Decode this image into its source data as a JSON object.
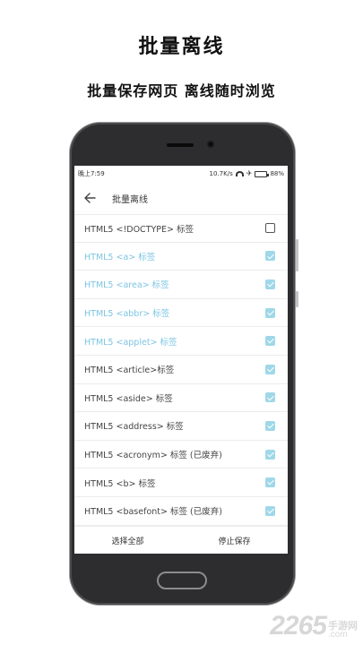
{
  "promo": {
    "title": "批量离线",
    "subtitle": "批量保存网页 离线随时浏览"
  },
  "status_bar": {
    "time": "晚上7:59",
    "net_speed": "10.7K/s",
    "battery": "88%",
    "battery_level": 0.88,
    "icons": [
      "wifi-icon",
      "airplane-icon",
      "battery-icon"
    ]
  },
  "app_bar": {
    "back_icon": "back-arrow-icon",
    "title": "批量离线"
  },
  "tag_list": {
    "items": [
      {
        "label": "HTML5 <!DOCTYPE> 标签",
        "checked": false,
        "highlight": false
      },
      {
        "label": "HTML5 <a> 标签",
        "checked": true,
        "highlight": true
      },
      {
        "label": "HTML5 <area> 标签",
        "checked": true,
        "highlight": true
      },
      {
        "label": "HTML5 <abbr> 标签",
        "checked": true,
        "highlight": true
      },
      {
        "label": "HTML5 <applet> 标签",
        "checked": true,
        "highlight": true
      },
      {
        "label": "HTML5 <article>标签",
        "checked": true,
        "highlight": false
      },
      {
        "label": "HTML5 <aside> 标签",
        "checked": true,
        "highlight": false
      },
      {
        "label": "HTML5 <address> 标签",
        "checked": true,
        "highlight": false
      },
      {
        "label": "HTML5 <acronym> 标签 (已废弃)",
        "checked": true,
        "highlight": false
      },
      {
        "label": "HTML5 <b> 标签",
        "checked": true,
        "highlight": false
      },
      {
        "label": "HTML5 <basefont> 标签 (已废弃)",
        "checked": true,
        "highlight": false
      }
    ]
  },
  "bottom_bar": {
    "select_all": "选择全部",
    "stop_save": "停止保存"
  },
  "watermark": {
    "number": "2265",
    "cn": "手游网",
    "domain": ".com"
  },
  "colors": {
    "highlight_text": "#7cc5e3",
    "checkbox_checked": "#9fd8e8",
    "phone_body": "#2d2d2f"
  }
}
